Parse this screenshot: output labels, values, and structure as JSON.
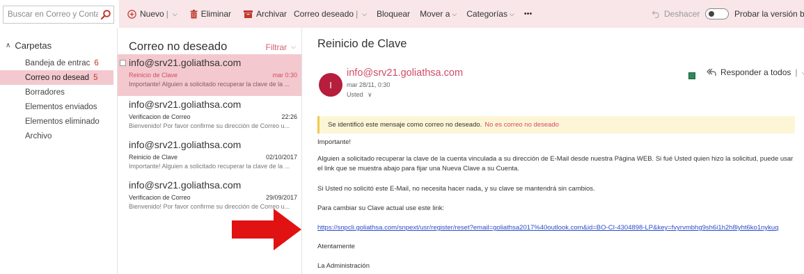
{
  "search": {
    "placeholder": "Buscar en Correo y Conta..."
  },
  "toolbar": {
    "new_label": "Nuevo",
    "delete_label": "Eliminar",
    "archive_label": "Archivar",
    "junk_label": "Correo deseado",
    "block_label": "Bloquear",
    "move_label": "Mover a",
    "categories_label": "Categorías",
    "more_label": "•••",
    "undo_label": "Deshacer",
    "beta_label": "Probar la versión beta"
  },
  "folders": {
    "heading": "Carpetas",
    "items": [
      {
        "label": "Bandeja de entrac",
        "count": "6"
      },
      {
        "label": "Correo no desead",
        "count": "5"
      },
      {
        "label": "Borradores",
        "count": ""
      },
      {
        "label": "Elementos enviados",
        "count": ""
      },
      {
        "label": "Elementos eliminado",
        "count": ""
      },
      {
        "label": "Archivo",
        "count": ""
      }
    ]
  },
  "list": {
    "title": "Correo no deseado",
    "filter_label": "Filtrar",
    "messages": [
      {
        "from": "info@srv21.goliathsa.com",
        "subject": "Reinicio de Clave",
        "time": "mar 0:30",
        "preview": "Importante! Alguien a solicitado recuperar la clave de la ..."
      },
      {
        "from": "info@srv21.goliathsa.com",
        "subject": "Verificacion de Correo",
        "time": "22:26",
        "preview": "Bienvenido! Por favor confirme su dirección de Correo u..."
      },
      {
        "from": "info@srv21.goliathsa.com",
        "subject": "Reinicio de Clave",
        "time": "02/10/2017",
        "preview": "Importante! Alguien a solicitado recuperar la clave de la ..."
      },
      {
        "from": "info@srv21.goliathsa.com",
        "subject": "Verificacion de Correo",
        "time": "29/09/2017",
        "preview": "Bienvenido! Por favor confirme su dirección de Correo u..."
      }
    ]
  },
  "reader": {
    "subject": "Reinicio de Clave",
    "avatar_letter": "I",
    "sender": "info@srv21.goliathsa.com",
    "date": "mar 28/11, 0:30",
    "to": "Usted",
    "reply_all_label": "Responder a todos",
    "junk_notice": "Se identificó este mensaje como correo no deseado.",
    "not_junk_link": "No es correo no deseado",
    "body": {
      "greeting": "Importante!",
      "p1": "Alguien a solicitado recuperar la clave de la cuenta vinculada a su dirección de E-Mail desde nuestra Página WEB. Si fué Usted quien hizo la solicitud, puede usar el link que se muestra abajo para fijar una Nueva Clave a su Cuenta.",
      "p2": "Si Usted no solicitó este E-Mail, no necesita hacer nada, y su clave se mantendrá sin cambios.",
      "p3": "Para cambiar su Clave actual use este link:",
      "link": "https://snpcli.goliathsa.com/snpext/usr/register/reset?email=goliathsa2017%40outlook.com&id=BO-CI-4304898-LP&key=fvyrvmbhg9sh6i1h2h8lyht6ko1nykuq",
      "closing": "Atentamente",
      "signature": "La Administración"
    }
  },
  "colors": {
    "accent": "#d24b67",
    "selected_bg": "#f3c9cf",
    "cmdbar_bg": "#f8e6e9",
    "avatar_bg": "#b51e3c",
    "warning_bg": "#fdf6d6",
    "link": "#2b4cc7",
    "arrow": "#e01212"
  }
}
